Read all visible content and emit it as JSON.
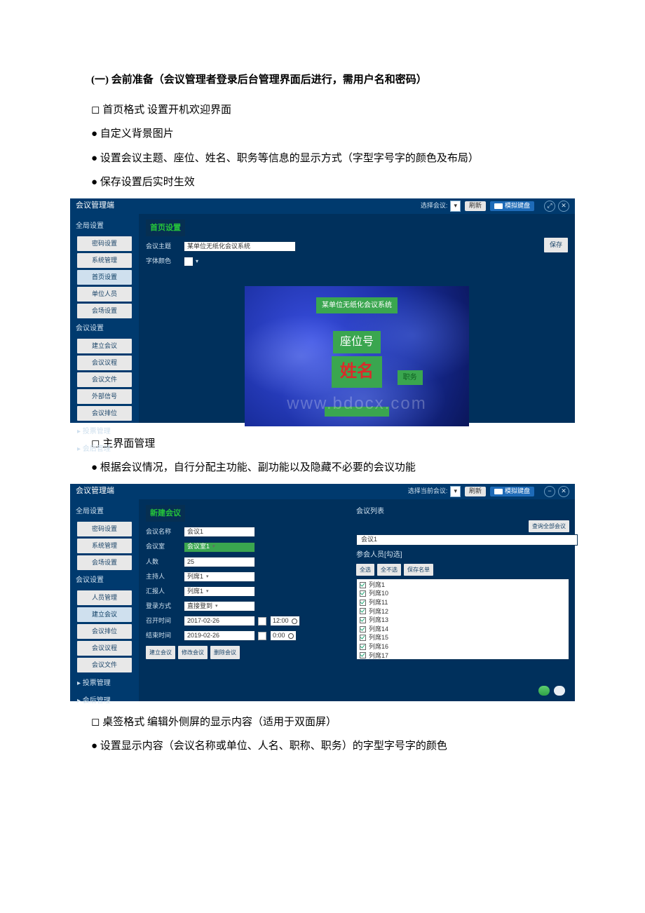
{
  "doc": {
    "h1": "(一) 会前准备（会议管理者登录后台管理界面后进行，需用户名和密码）",
    "p1": "◻ 首页格式 设置开机欢迎界面",
    "p2": "● 自定义背景图片",
    "p3": "● 设置会议主题、座位、姓名、职务等信息的显示方式（字型字号字的颜色及布局）",
    "p4": "● 保存设置后实时生效",
    "p5": "◻ 主界面管理",
    "p6": "● 根据会议情况，自行分配主功能、副功能以及隐藏不必要的会议功能",
    "p7": "◻ 桌签格式 编辑外侧屏的显示内容（适用于双面屏）",
    "p8": "● 设置显示内容（会议名称或单位、人名、职称、职务）的字型字号字的颜色"
  },
  "shot1": {
    "header": {
      "title": "会议管理端",
      "select_label": "选择会议:",
      "select_tri": "▾",
      "refresh": "刷新",
      "vkb": "模拟键盘",
      "zoom": "⤢",
      "close": "✕"
    },
    "sidebar": {
      "g1": "全局设置",
      "g1_items": [
        "密码设置",
        "系统管理",
        "首页设置",
        "单位人员",
        "会场设置"
      ],
      "g2": "会议设置",
      "g2_items": [
        "建立会议",
        "会议议程",
        "会议文件",
        "外部信号",
        "会议排位"
      ],
      "l1": "▸ 投票管理",
      "l2": "▸ 会后管理"
    },
    "panel": {
      "title": "首页设置",
      "row1_label": "会议主题",
      "row1_value": "某单位无纸化会议系统",
      "row2_label": "字体颜色",
      "save": "保存"
    },
    "preview": {
      "title": "某单位无纸化会议系统",
      "seat": "座位号",
      "name": "姓名",
      "job": "职务",
      "bottom": ""
    },
    "watermark": "www.bdocx.com"
  },
  "shot2": {
    "header": {
      "title": "会议管理端",
      "select_label": "选择当前会议:",
      "select_tri": "▾",
      "refresh": "刷新",
      "vkb": "模拟键盘",
      "min": "−",
      "close": "✕"
    },
    "sidebar": {
      "g1": "全局设置",
      "g1_items": [
        "密码设置",
        "系统管理",
        "会场设置"
      ],
      "g2": "会议设置",
      "g2_items": [
        "人员管理",
        "建立会议",
        "会议排位",
        "会议议程",
        "会议文件"
      ],
      "l1": "▸ 投票管理",
      "l2": "▸ 会后管理"
    },
    "form": {
      "title": "新建会议",
      "name_label": "会议名称",
      "name_value": "会议1",
      "room_label": "会议室",
      "room_value": "会议室1",
      "count_label": "人数",
      "count_value": "25",
      "host_label": "主持人",
      "host_value": "列席1",
      "reporter_label": "汇报人",
      "reporter_value": "列席1",
      "login_label": "登录方式",
      "login_value": "直接登到",
      "start_label": "召开时间",
      "start_date": "2017-02-26",
      "start_time": "12:00",
      "end_label": "结束时间",
      "end_date": "2019-02-26",
      "end_time": "0:00",
      "btn_create": "建立会议",
      "btn_modify": "修改会议",
      "btn_delete": "删除会议"
    },
    "right": {
      "title": "会议列表",
      "search_btn": "查询全部会议",
      "box_value": "会议1",
      "subtitle": "参会人员[勾选]",
      "btn_all": "全选",
      "btn_none": "全不选",
      "btn_save": "保存名单",
      "list": [
        "列席1",
        "列席10",
        "列席11",
        "列席12",
        "列席13",
        "列席14",
        "列席15",
        "列席16",
        "列席17"
      ]
    },
    "footer": {
      "pill1": "",
      "pill2": ""
    }
  }
}
